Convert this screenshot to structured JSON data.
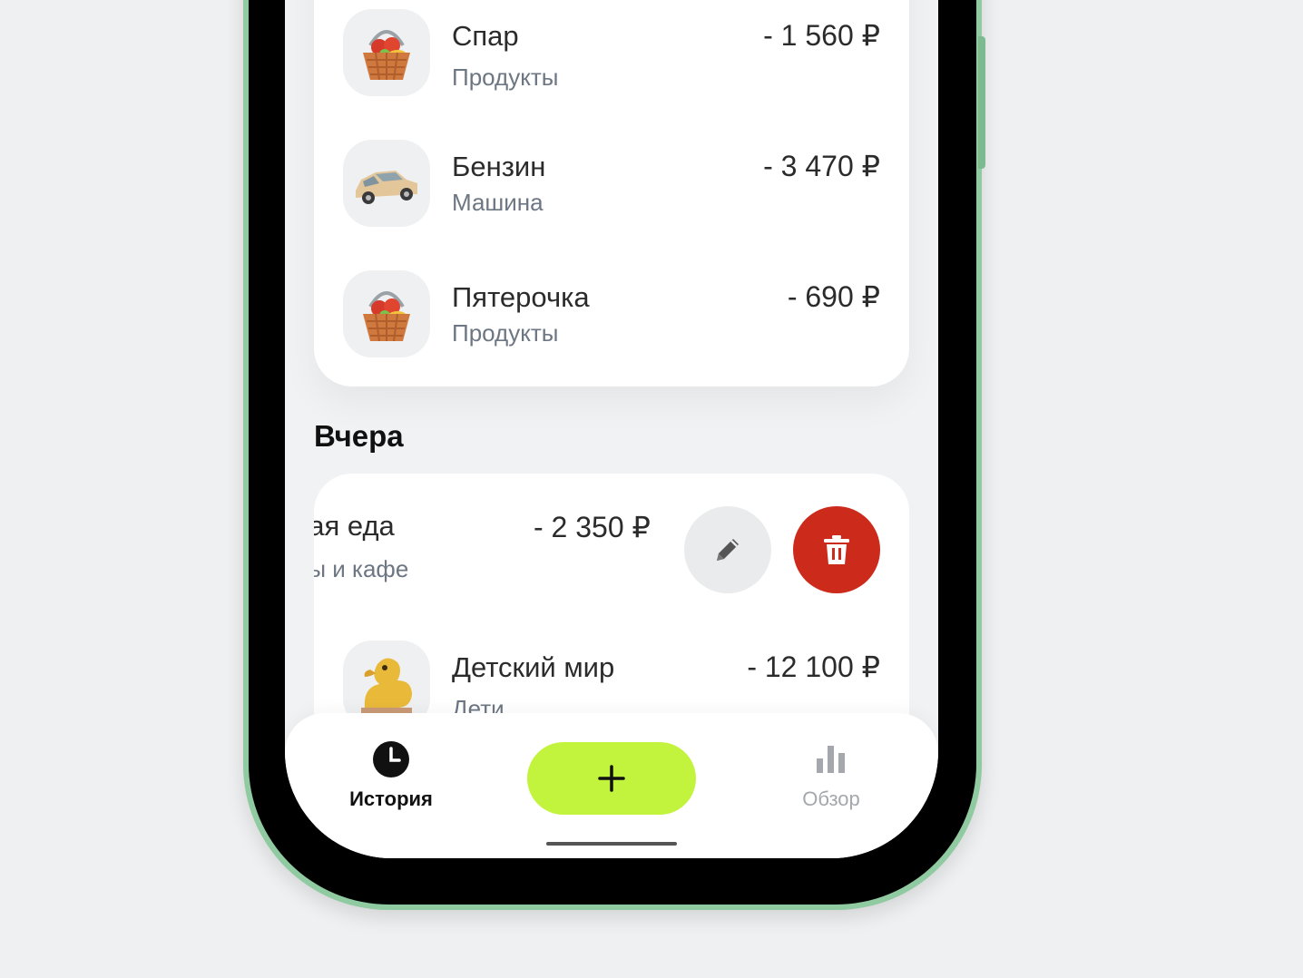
{
  "today": {
    "transactions": [
      {
        "title": "Спар",
        "category": "Продукты",
        "amount": "- 1 560 ₽",
        "icon": "basket-icon"
      },
      {
        "title": "Бензин",
        "category": "Машина",
        "amount": "- 3 470 ₽",
        "icon": "car-icon"
      },
      {
        "title": "Пятерочка",
        "category": "Продукты",
        "amount": "- 690 ₽",
        "icon": "basket-icon"
      }
    ]
  },
  "yesterday": {
    "section_title": "Вчера",
    "swiped": {
      "title": "кая еда",
      "category": "ны и кафе",
      "amount": "- 2 350 ₽"
    },
    "transactions": [
      {
        "title": "Детский мир",
        "category": "Дети",
        "amount": "- 12 100 ₽",
        "icon": "duck-toy-icon"
      }
    ]
  },
  "tabbar": {
    "history_label": "История",
    "overview_label": "Обзор",
    "add_icon": "plus-icon"
  },
  "colors": {
    "accent_green": "#c2f33d",
    "delete_red": "#cc2a1b",
    "phone_frame": "#8fcaa0"
  }
}
